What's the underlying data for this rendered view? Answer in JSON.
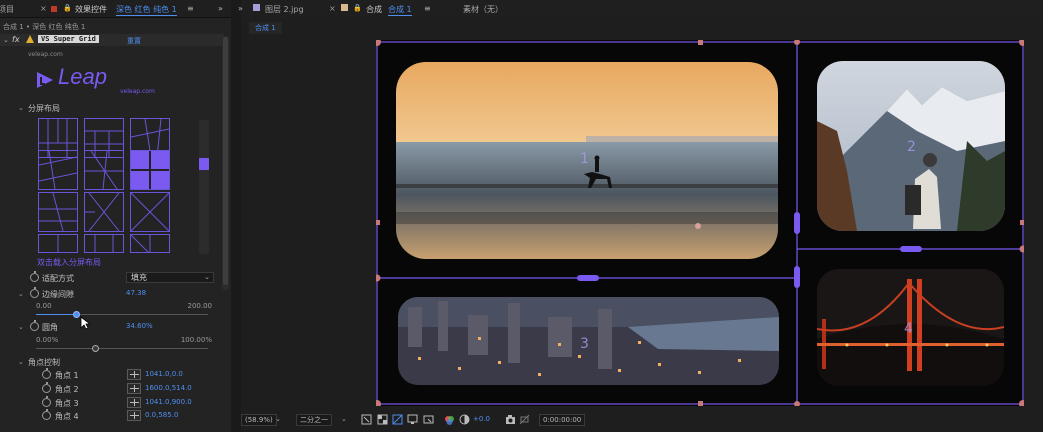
{
  "left": {
    "tabs": {
      "project_tab": "项目",
      "effects_tab": "效果控件",
      "layer_name": "深色 红色 纯色 1"
    },
    "breadcrumb": "合成 1 • 深色 红色 纯色 1",
    "effect": {
      "fx": "fx",
      "plugin_name": "VS Super Grid",
      "reset_label": "重置",
      "website": "veleap.com"
    },
    "logo": {
      "wordmark": "Leap",
      "url": "veleap.com"
    },
    "layout_section": "分屏布局",
    "layout_hint": "双击载入分屏布局",
    "properties": {
      "fit_mode_label": "适配方式",
      "fit_mode_value": "填充",
      "edge_spacing_label": "边缘间隙",
      "edge_spacing_value": "47.38",
      "edge_min": "0.00",
      "edge_max": "200.00",
      "edge_fraction": 0.237,
      "corner_radius_label": "圆角",
      "corner_radius_value": "34.60%",
      "radius_min": "0.00%",
      "radius_max": "100.00%",
      "radius_fraction": 0.346
    },
    "corner_section": "角点控制",
    "corners": [
      {
        "label": "角点 1",
        "value": "1041.0,0.0"
      },
      {
        "label": "角点 2",
        "value": "1600.0,514.0"
      },
      {
        "label": "角点 3",
        "value": "1041.0,900.0"
      },
      {
        "label": "角点 4",
        "value": "0.0,585.0"
      }
    ]
  },
  "right": {
    "tabs": {
      "layer_tab": "图层 2.jpg",
      "comp_tab_prefix": "合成",
      "comp_tab_name": "合成 1",
      "footage_tab": "素材（无）"
    },
    "sub_tab": "合成 1",
    "cells": [
      {
        "number": "1",
        "subject": "horse rider on beach at sunset"
      },
      {
        "number": "2",
        "subject": "hiker and snowy mountains"
      },
      {
        "number": "3",
        "subject": "city aerial at dusk"
      },
      {
        "number": "4",
        "subject": "golden gate bridge at night"
      }
    ],
    "bottom_bar": {
      "zoom": "(58.9%)",
      "resolution": "二分之一",
      "exposure": "+0.0",
      "timecode": "0:00:00:00"
    }
  },
  "colors": {
    "accent_purple": "#7a5af0",
    "value_blue": "#4f8ff0",
    "panel_bg": "#232323",
    "viewer_bg": "#070707",
    "handle_pink": "#d68080"
  }
}
